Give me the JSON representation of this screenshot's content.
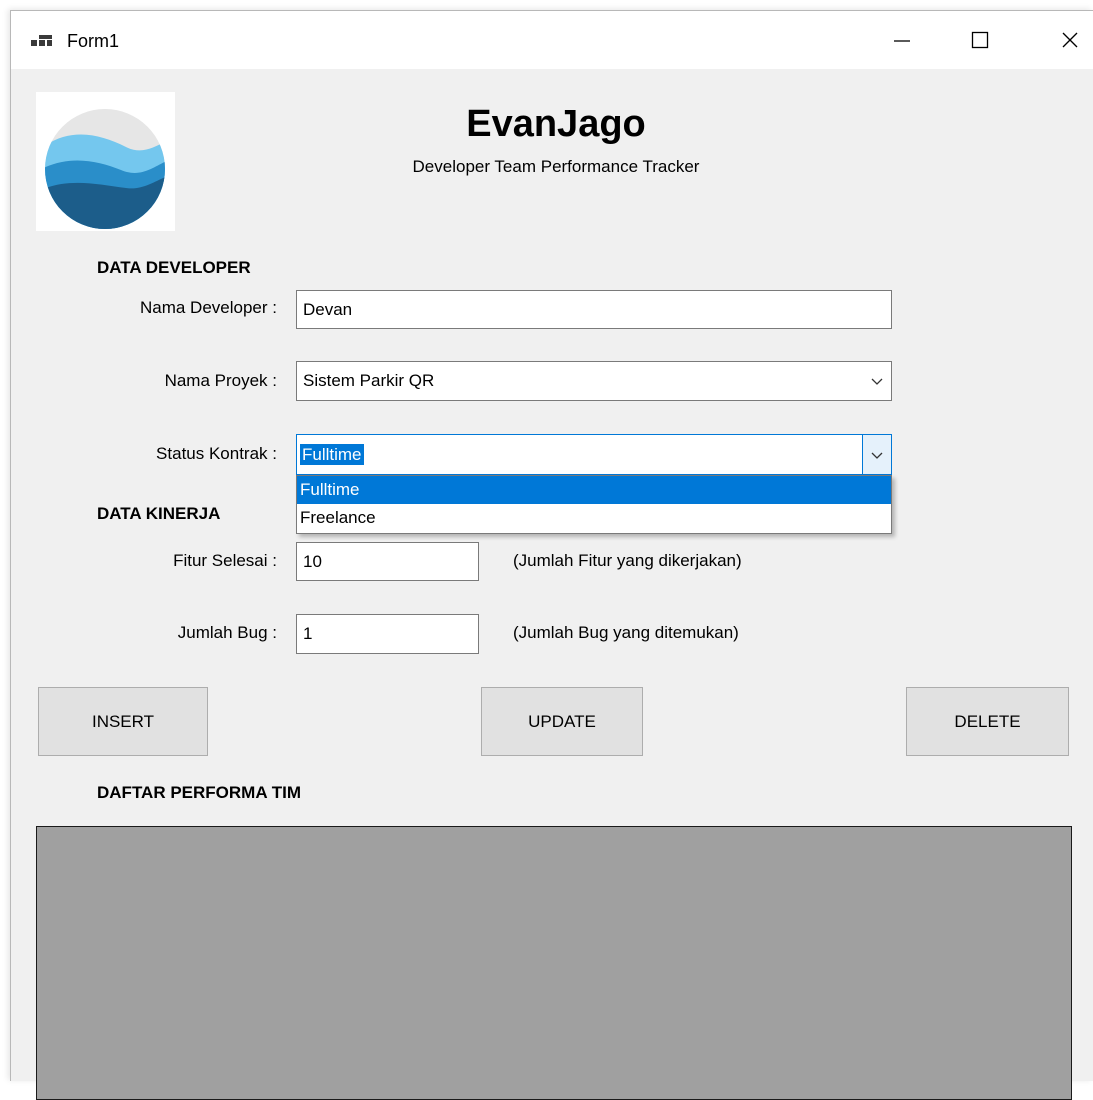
{
  "window": {
    "title": "Form1"
  },
  "header": {
    "app_name": "EvanJago",
    "subtitle": "Developer Team Performance Tracker",
    "logo_icon": "waves-logo-icon"
  },
  "sections": {
    "developer": "DATA DEVELOPER",
    "kinerja": "DATA KINERJA",
    "daftar": "DAFTAR PERFORMA TIM"
  },
  "fields": {
    "nama_developer": {
      "label": "Nama Developer :",
      "value": "Devan"
    },
    "nama_proyek": {
      "label": "Nama Proyek :",
      "value": "Sistem Parkir QR"
    },
    "status_kontrak": {
      "label": "Status Kontrak :",
      "value": "Fulltime",
      "options": [
        "Fulltime",
        "Freelance"
      ],
      "highlighted": "Fulltime"
    },
    "fitur_selesai": {
      "label": "Fitur Selesai :",
      "value": "10",
      "hint": "(Jumlah Fitur yang dikerjakan)"
    },
    "jumlah_bug": {
      "label": "Jumlah Bug :",
      "value": "1",
      "hint": "(Jumlah Bug yang ditemukan)"
    }
  },
  "buttons": {
    "insert": "INSERT",
    "update": "UPDATE",
    "delete": "DELETE"
  },
  "colors": {
    "accent": "#0078d7",
    "form_bg": "#f0f0f0",
    "grid_bg": "#a0a0a0",
    "logo_light": "#74c7ee",
    "logo_mid": "#2a8ec9",
    "logo_dark": "#1c5d8a"
  }
}
